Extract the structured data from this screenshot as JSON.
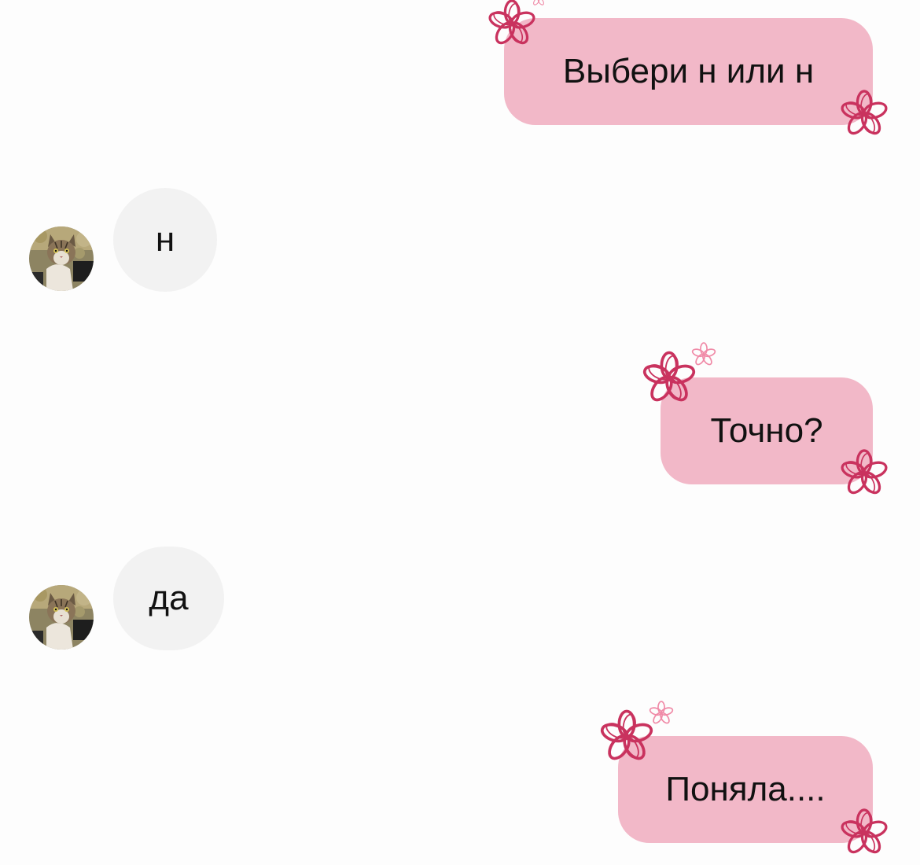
{
  "conversation": {
    "messages": [
      {
        "side": "outgoing",
        "text": "Выбери н или н"
      },
      {
        "side": "incoming",
        "text": "н"
      },
      {
        "side": "outgoing",
        "text": "Точно?"
      },
      {
        "side": "incoming",
        "text": "да"
      },
      {
        "side": "outgoing",
        "text": "Поняла...."
      }
    ]
  },
  "theme": {
    "outgoing_bubble_color": "#f2b8c8",
    "incoming_bubble_color": "#f2f2f2",
    "flower_color": "#c9325e",
    "small_flower_color": "#f08aa7",
    "background_color": "#fdfdfd"
  },
  "icons": {
    "avatar": "cat-avatar",
    "decoration": "flower-icon"
  }
}
